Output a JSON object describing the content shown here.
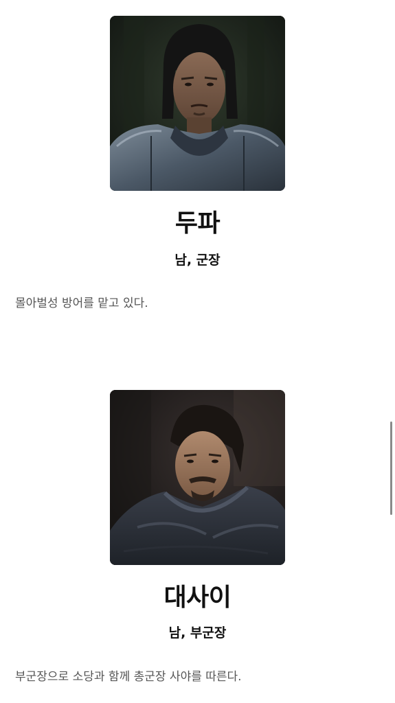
{
  "characters": [
    {
      "name": "두파",
      "role": "남, 군장",
      "description": "몰아벌성 방어를 맡고 있다.",
      "portrait_icon": "portrait-armored-warrior"
    },
    {
      "name": "대사이",
      "role": "남, 부군장",
      "description": "부군장으로 소당과 함께 총군장 사야를 따른다.",
      "portrait_icon": "portrait-cloaked-warrior"
    }
  ],
  "colors": {
    "text": "#111111",
    "description": "#555555",
    "scrollbar": "#8a8a8a"
  }
}
